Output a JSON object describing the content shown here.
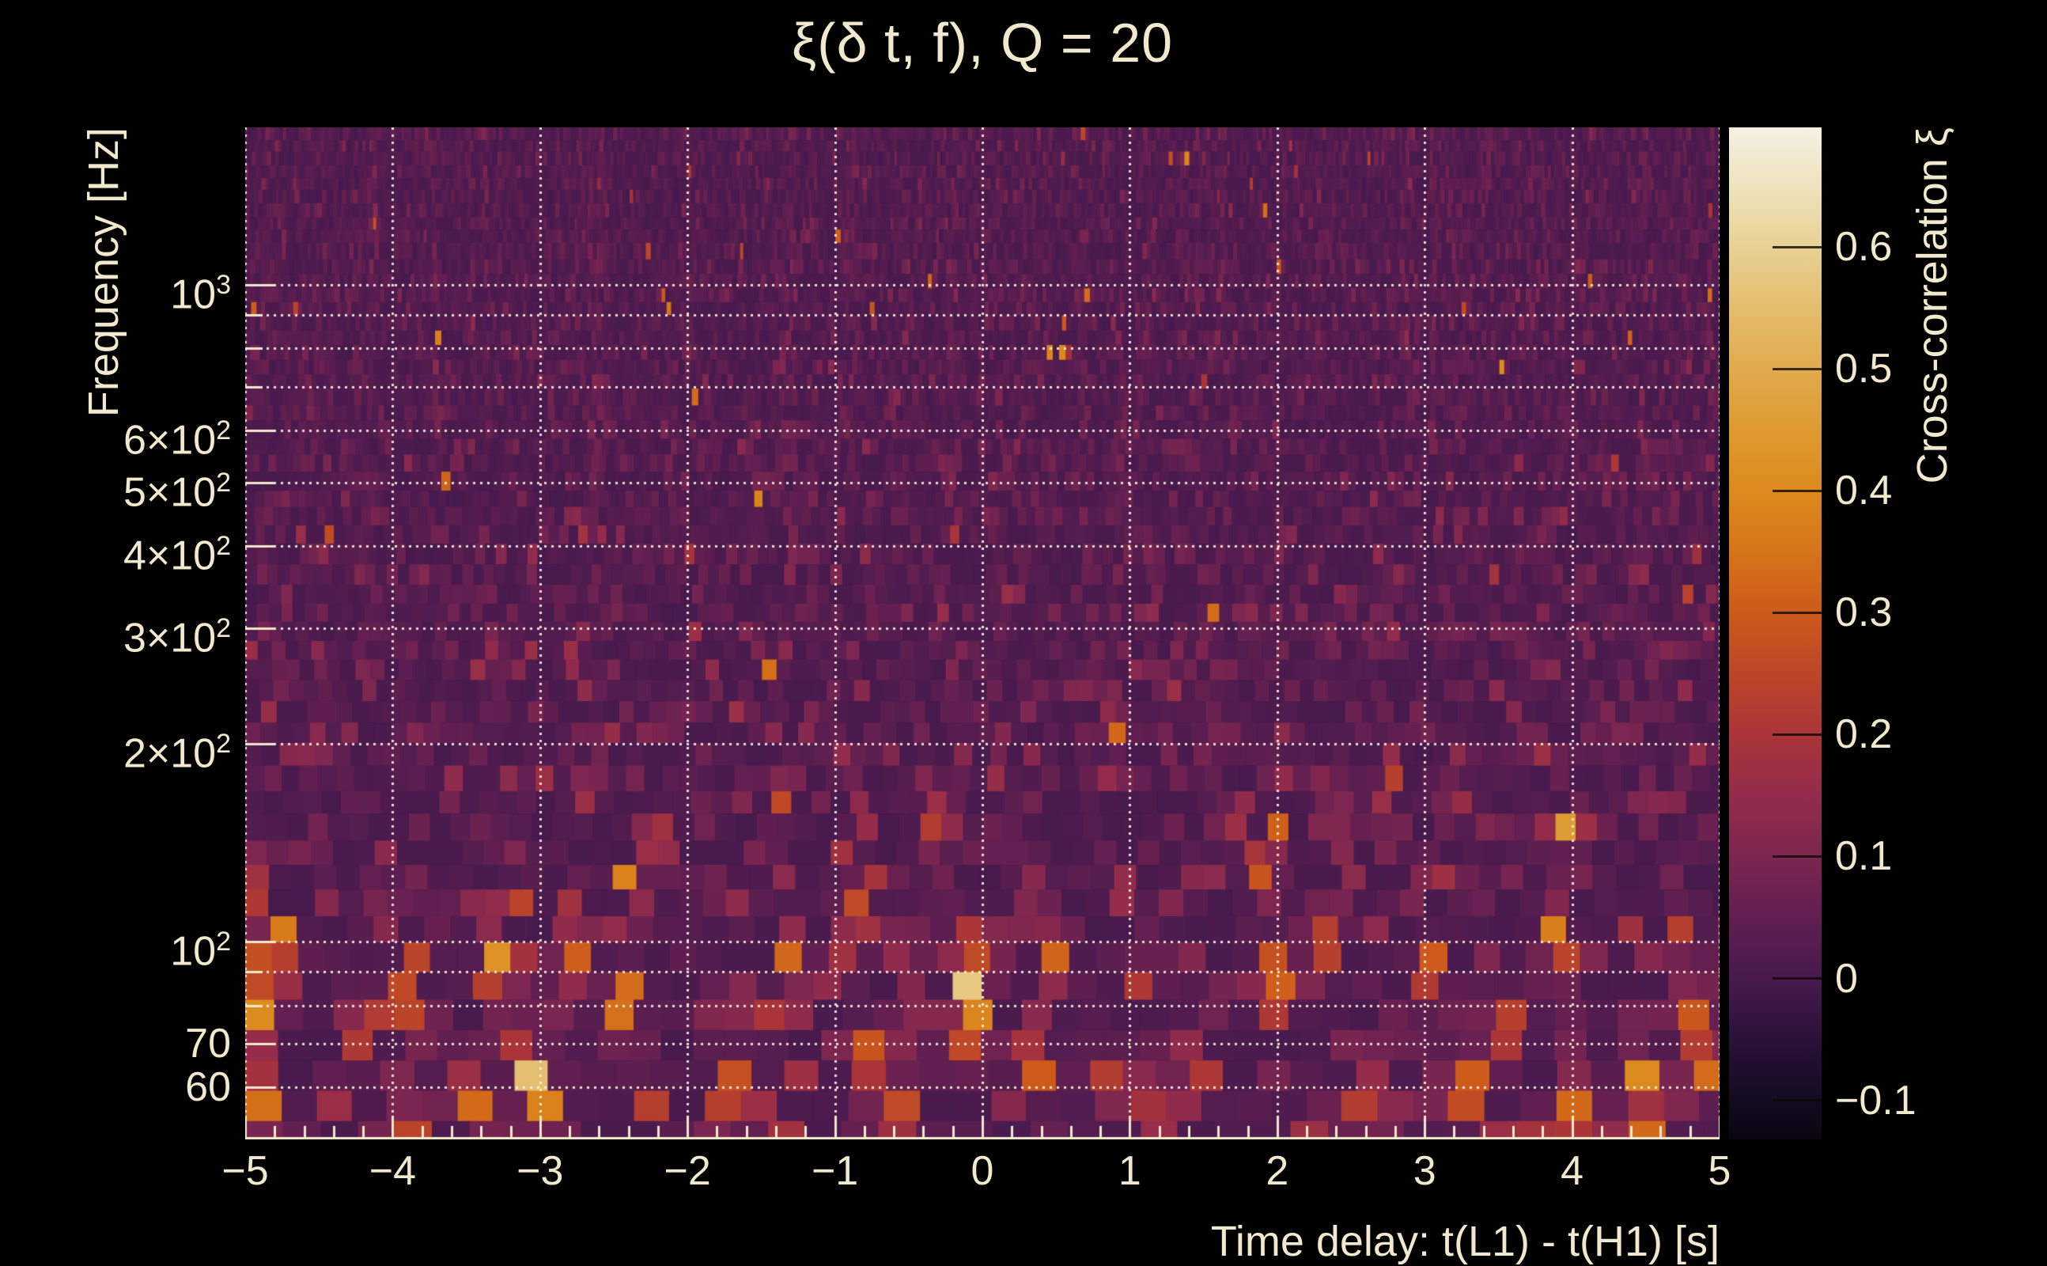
{
  "title": "ξ(δ t, f), Q = 20",
  "colors": {
    "background": "#000000",
    "text": "#f1e8cd",
    "grid": "rgba(247,240,225,0.92)",
    "axis": "#f1e8cd",
    "colorbar_tick": "rgba(12,9,4,0.8)"
  },
  "chart_data": {
    "type": "heatmap",
    "title": "ξ(δ t, f), Q = 20",
    "xlabel": "Time delay: t(L1) - t(H1) [s]",
    "ylabel": "Frequency [Hz]",
    "zlabel": "Cross-correlation ξ",
    "x_range": [
      -5,
      5
    ],
    "x_ticks": [
      {
        "v": -5,
        "label": "−5"
      },
      {
        "v": -4,
        "label": "−4"
      },
      {
        "v": -3,
        "label": "−3"
      },
      {
        "v": -2,
        "label": "−2"
      },
      {
        "v": -1,
        "label": "−1"
      },
      {
        "v": 0,
        "label": "0"
      },
      {
        "v": 1,
        "label": "1"
      },
      {
        "v": 2,
        "label": "2"
      },
      {
        "v": 3,
        "label": "3"
      },
      {
        "v": 4,
        "label": "4"
      },
      {
        "v": 5,
        "label": "5"
      }
    ],
    "x_minor_step": 0.2,
    "y_scale": "log",
    "y_range": [
      50,
      1737
    ],
    "y_gridlines": [
      1000,
      900,
      800,
      700,
      600,
      500,
      400,
      300,
      200,
      100,
      90,
      80,
      70,
      60
    ],
    "y_tick_labels": [
      {
        "f": 1000,
        "base": "10",
        "exp": "3"
      },
      {
        "f": 600,
        "base": "6×10",
        "exp": "2"
      },
      {
        "f": 500,
        "base": "5×10",
        "exp": "2"
      },
      {
        "f": 400,
        "base": "4×10",
        "exp": "2"
      },
      {
        "f": 300,
        "base": "3×10",
        "exp": "2"
      },
      {
        "f": 200,
        "base": "2×10",
        "exp": "2"
      },
      {
        "f": 100,
        "base": "10",
        "exp": "2"
      },
      {
        "f": 70,
        "base": "70",
        "exp": ""
      },
      {
        "f": 60,
        "base": "60",
        "exp": ""
      }
    ],
    "z_range": [
      -0.132,
      0.698
    ],
    "z_ticks": [
      {
        "v": 0.6,
        "label": "0.6"
      },
      {
        "v": 0.5,
        "label": "0.5"
      },
      {
        "v": 0.4,
        "label": "0.4"
      },
      {
        "v": 0.3,
        "label": "0.3"
      },
      {
        "v": 0.2,
        "label": "0.2"
      },
      {
        "v": 0.1,
        "label": "0.1"
      },
      {
        "v": 0,
        "label": "0"
      },
      {
        "v": -0.1,
        "label": "−0.1"
      }
    ],
    "colormap": [
      {
        "v": -0.132,
        "c": "#0a0510"
      },
      {
        "v": -0.1,
        "c": "#140b22"
      },
      {
        "v": -0.05,
        "c": "#2a1238"
      },
      {
        "v": 0.0,
        "c": "#471a4e"
      },
      {
        "v": 0.05,
        "c": "#611f50"
      },
      {
        "v": 0.1,
        "c": "#7c2650"
      },
      {
        "v": 0.15,
        "c": "#932c4b"
      },
      {
        "v": 0.2,
        "c": "#aa3538"
      },
      {
        "v": 0.25,
        "c": "#bc4628"
      },
      {
        "v": 0.3,
        "c": "#cd5a1b"
      },
      {
        "v": 0.35,
        "c": "#d57419"
      },
      {
        "v": 0.4,
        "c": "#dc8a1e"
      },
      {
        "v": 0.45,
        "c": "#de9a30"
      },
      {
        "v": 0.5,
        "c": "#e1aa4c"
      },
      {
        "v": 0.55,
        "c": "#e4bd6e"
      },
      {
        "v": 0.6,
        "c": "#e7d194"
      },
      {
        "v": 0.65,
        "c": "#eee3bd"
      },
      {
        "v": 0.698,
        "c": "#f5f1e2"
      }
    ],
    "noise": {
      "seed": 1337,
      "mean": 0.018,
      "sd_top": 0.032,
      "sd_bottom": 0.107
    },
    "hotspots": [
      {
        "dt": -0.07,
        "f": 86,
        "xi": 0.67
      },
      {
        "dt": -0.05,
        "f": 74,
        "xi": 0.52
      },
      {
        "dt": -0.1,
        "f": 95,
        "xi": 0.4
      },
      {
        "dt": -0.6,
        "f": 55,
        "xi": 0.35
      },
      {
        "dt": -4.97,
        "f": 90,
        "xi": 0.46
      },
      {
        "dt": -4.95,
        "f": 77,
        "xi": 0.5
      },
      {
        "dt": -4.9,
        "f": 57,
        "xi": 0.38
      },
      {
        "dt": -4.97,
        "f": 120,
        "xi": 0.3
      },
      {
        "dt": -4.2,
        "f": 75,
        "xi": 0.35
      },
      {
        "dt": -3.93,
        "f": 80,
        "xi": 0.33
      },
      {
        "dt": -3.28,
        "f": 90,
        "xi": 0.5
      },
      {
        "dt": -3.05,
        "f": 62,
        "xi": 0.58
      },
      {
        "dt": -2.98,
        "f": 54,
        "xi": 0.45
      },
      {
        "dt": -3.4,
        "f": 57,
        "xi": 0.35
      },
      {
        "dt": -2.75,
        "f": 95,
        "xi": 0.32
      },
      {
        "dt": -2.45,
        "f": 80,
        "xi": 0.35
      },
      {
        "dt": -2.2,
        "f": 140,
        "xi": 0.28
      },
      {
        "dt": -1.7,
        "f": 60,
        "xi": 0.33
      },
      {
        "dt": -1.75,
        "f": 75,
        "xi": 0.3
      },
      {
        "dt": -1.3,
        "f": 95,
        "xi": 0.33
      },
      {
        "dt": -0.85,
        "f": 110,
        "xi": 0.32
      },
      {
        "dt": -0.3,
        "f": 150,
        "xi": 0.28
      },
      {
        "dt": 0.35,
        "f": 65,
        "xi": 0.33
      },
      {
        "dt": 0.5,
        "f": 95,
        "xi": 0.3
      },
      {
        "dt": 0.8,
        "f": 60,
        "xi": 0.3
      },
      {
        "dt": 1.2,
        "f": 55,
        "xi": 0.32
      },
      {
        "dt": 1.42,
        "f": 63,
        "xi": 0.42
      },
      {
        "dt": 1.9,
        "f": 130,
        "xi": 0.28
      },
      {
        "dt": 2.0,
        "f": 90,
        "xi": 0.36
      },
      {
        "dt": 2.3,
        "f": 100,
        "xi": 0.3
      },
      {
        "dt": 2.6,
        "f": 55,
        "xi": 0.32
      },
      {
        "dt": 3.05,
        "f": 90,
        "xi": 0.33
      },
      {
        "dt": 3.3,
        "f": 60,
        "xi": 0.35
      },
      {
        "dt": 3.55,
        "f": 75,
        "xi": 0.3
      },
      {
        "dt": 3.9,
        "f": 100,
        "xi": 0.44
      },
      {
        "dt": 3.95,
        "f": 55,
        "xi": 0.52
      },
      {
        "dt": 4.1,
        "f": 58,
        "xi": 0.38
      },
      {
        "dt": 4.5,
        "f": 62,
        "xi": 0.44
      },
      {
        "dt": 4.85,
        "f": 80,
        "xi": 0.33
      },
      {
        "dt": 4.93,
        "f": 66,
        "xi": 0.5
      }
    ],
    "description": "Q-transform cross-correlation ξ between LIGO L1 and H1 as a function of time delay (−5 to 5 s) and frequency (50–1737 Hz, log scale). Mostly dark purple noise near ξ≈0 with scattered orange excesses below ~200 Hz; brightest correlation blob (ξ≈0.65–0.7) near δt≈0 at 70–90 Hz."
  }
}
